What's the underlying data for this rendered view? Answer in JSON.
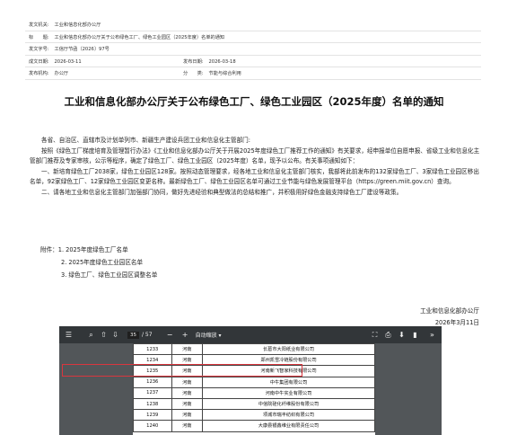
{
  "meta": {
    "issuer_label": "发文机关:",
    "issuer_value": "工业和信息化部办公厅",
    "title_label": "标　　题:",
    "title_value": "工业和信息化部办公厅关于公布绿色工厂、绿色工业园区（2025年度）名单的通知",
    "docno_label": "发文字号:",
    "docno_value": "工信厅节函〔2026〕97号",
    "written_label": "成文日期:",
    "written_value": "2026-03-11",
    "published_label": "发布日期:",
    "published_value": "2026-03-18",
    "org_label": "发布机构:",
    "org_value": "办公厅",
    "category_label": "分　　类:",
    "category_value": "节能与综合利用"
  },
  "doc": {
    "title": "工业和信息化部办公厅关于公布绿色工厂、绿色工业园区（2025年度）名单的通知",
    "salutation": "各省、自治区、直辖市及计划单列市、新疆生产建设兵团工业和信息化主管部门:",
    "para1": "按照《绿色工厂梯度培育及管理暂行办法》《工业和信息化部办公厅关于开展2025年度绿色工厂推荐工作的通知》有关要求，经申报单位自愿申报、省级工业和信息化主管部门推荐及专家审核，公示等程序，确定了绿色工厂、绿色工业园区（2025年度）名单，现予以公布。有关事项通知如下：",
    "para2": "一、新培育绿色工厂2038家，绿色工业园区128家。按照动态管理要求，经各地工业和信息化主管部门核实，我部将此前发布的132家绿色工厂、3家绿色工业园区移出名单，92家绿色工厂、12家绿色工业园区变更名称。最新绿色工厂、绿色工业园区名单可通过工业节能与绿色发展管理平台（https://green.miit.gov.cn）查询。",
    "para3": "二、请各地工业和信息化主管部门加强部门协同，做好先进经验和典型做法的总结和推广，并积极用好绿色金融支持绿色工厂建设等政策。",
    "attach1": "附件：1. 2025年度绿色工厂名单",
    "attach2": "2. 2025年度绿色工业园区名单",
    "attach3": "3. 绿色工厂、绿色工业园区调整名单",
    "sign_org": "工业和信息化部办公厅",
    "sign_date": "2026年3月11日"
  },
  "viewer": {
    "page_current": "35",
    "page_total": "/ 57",
    "zoom_label": "自动缩放",
    "minus": "−",
    "plus": "+",
    "icons": [
      "sidebar-toggle-icon",
      "search-icon",
      "arrow-up-icon",
      "arrow-down-icon",
      "zoom-out-icon",
      "zoom-in-icon",
      "fullscreen-icon",
      "print-icon",
      "download-icon",
      "bookmark-icon",
      "more-tools-icon"
    ],
    "highlight_color": "#d9363e"
  },
  "table": {
    "rows": [
      [
        "1233",
        "河南",
        "长葛市大阳纸业有限公司"
      ],
      [
        "1234",
        "河南",
        "郑州凯雪冷链股份有限公司"
      ],
      [
        "1235",
        "河南",
        "河南新飞智家科技有限公司"
      ],
      [
        "1236",
        "河南",
        "中牛集团有限公司"
      ],
      [
        "1237",
        "河南",
        "河南中牛实业有限公司"
      ],
      [
        "1238",
        "河南",
        "中信院硅化纤维股份有限公司"
      ],
      [
        "1239",
        "河南",
        "项城市瑞丰纺织有限公司"
      ],
      [
        "1240",
        "河南",
        "大康县银鑫维业有限责任公司"
      ]
    ]
  }
}
